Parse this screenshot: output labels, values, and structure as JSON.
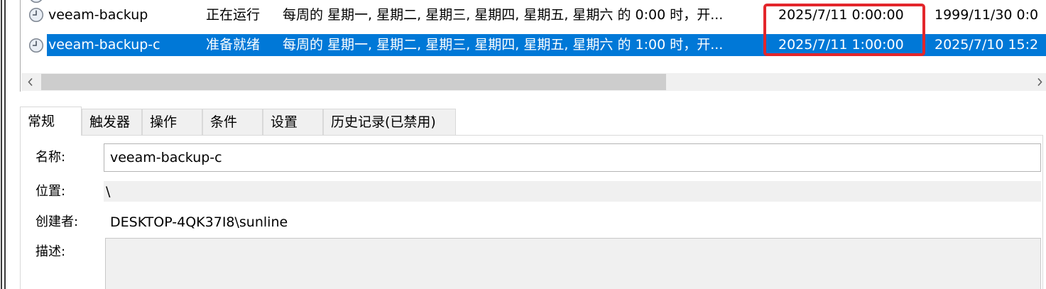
{
  "colors": {
    "selection": "#0078d7",
    "selection_text": "#ffffff",
    "annotation": "#e3262b",
    "readonly_field": "#f0f0f0",
    "inactive_tab": "#f0f0f0",
    "scroll_thumb": "#cdcdcd"
  },
  "task_list": {
    "rows": [
      {
        "icon": "task-clock-icon",
        "name": "veeam-backup",
        "status": "正在运行",
        "triggers": "每周的 星期一, 星期二, 星期三, 星期四, 星期五, 星期六 的 0:00 时，开...",
        "next_run_time": "2025/7/11 0:00:00",
        "last_run_time": "1999/11/30 0:0",
        "selected": false
      },
      {
        "icon": "task-clock-icon",
        "name": "veeam-backup-c",
        "status": "准备就绪",
        "triggers": "每周的 星期一, 星期二, 星期三, 星期四, 星期五, 星期六 的 1:00 时，开...",
        "next_run_time": "2025/7/11 1:00:00",
        "last_run_time": "2025/7/10 15:2",
        "selected": true
      }
    ],
    "horizontal_scrollbar": {
      "left_icon": "chevron-left-icon",
      "right_icon": "chevron-right-icon",
      "scroll_position": 0,
      "visible_fraction": 0.63
    }
  },
  "details": {
    "tabs": {
      "items": [
        "常规",
        "触发器",
        "操作",
        "条件",
        "设置",
        "历史记录(已禁用)"
      ],
      "selected_index": 0
    },
    "general": {
      "name_label": "名称:",
      "name_value": "veeam-backup-c",
      "location_label": "位置:",
      "location_value": "\\",
      "author_label": "创建者:",
      "author_value": "DESKTOP-4QK37I8\\sunline",
      "description_label": "描述:",
      "description_value": ""
    }
  }
}
